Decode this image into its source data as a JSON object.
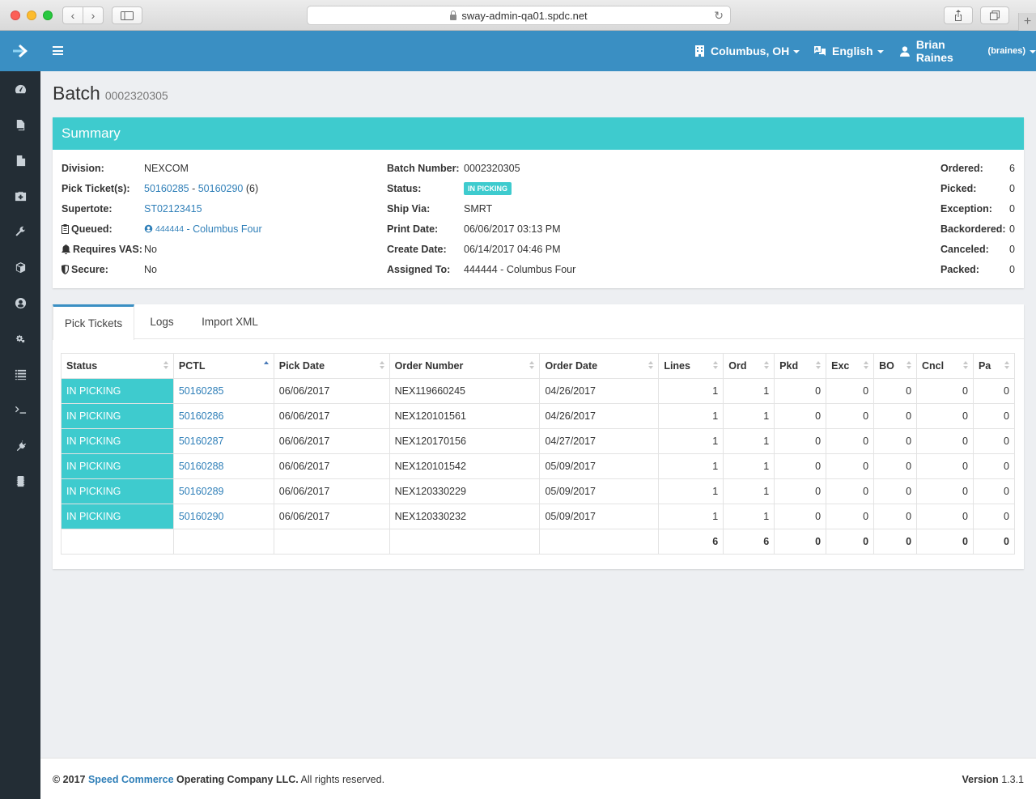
{
  "browser": {
    "url": "sway-admin-qa01.spdc.net"
  },
  "topbar": {
    "location": "Columbus, OH",
    "language": "English",
    "user_name": "Brian Raines",
    "user_login": "(braines)"
  },
  "page": {
    "title": "Batch",
    "subtitle": "0002320305"
  },
  "summary": {
    "title": "Summary",
    "division_label": "Division:",
    "division": "NEXCOM",
    "pick_tickets_label": "Pick Ticket(s):",
    "pick_ticket_first": "50160285",
    "pick_ticket_sep": " - ",
    "pick_ticket_last": "50160290",
    "pick_ticket_count": "(6)",
    "supertote_label": "Supertote:",
    "supertote": "ST02123415",
    "queued_label": "Queued:",
    "queued_id": "444444",
    "queued_name": " - Columbus Four",
    "vas_label": "Requires VAS:",
    "vas": "No",
    "secure_label": "Secure:",
    "secure": "No",
    "batch_number_label": "Batch Number:",
    "batch_number": "0002320305",
    "status_label": "Status:",
    "status": "IN PICKING",
    "ship_via_label": "Ship Via:",
    "ship_via": "SMRT",
    "print_date_label": "Print Date:",
    "print_date": "06/06/2017 03:13 PM",
    "create_date_label": "Create Date:",
    "create_date": "06/14/2017 04:46 PM",
    "assigned_to_label": "Assigned To:",
    "assigned_to": "444444 - Columbus Four",
    "ordered_label": "Ordered:",
    "ordered": "6",
    "picked_label": "Picked:",
    "picked": "0",
    "exception_label": "Exception:",
    "exception": "0",
    "backordered_label": "Backordered:",
    "backordered": "0",
    "canceled_label": "Canceled:",
    "canceled": "0",
    "packed_label": "Packed:",
    "packed": "0"
  },
  "tabs": [
    "Pick Tickets",
    "Logs",
    "Import XML"
  ],
  "table": {
    "headers": [
      "Status",
      "PCTL",
      "Pick Date",
      "Order Number",
      "Order Date",
      "Lines",
      "Ord",
      "Pkd",
      "Exc",
      "BO",
      "Cncl",
      "Pa"
    ],
    "rows": [
      [
        "IN PICKING",
        "50160285",
        "06/06/2017",
        "NEX119660245",
        "04/26/2017",
        "1",
        "1",
        "0",
        "0",
        "0",
        "0",
        "0"
      ],
      [
        "IN PICKING",
        "50160286",
        "06/06/2017",
        "NEX120101561",
        "04/26/2017",
        "1",
        "1",
        "0",
        "0",
        "0",
        "0",
        "0"
      ],
      [
        "IN PICKING",
        "50160287",
        "06/06/2017",
        "NEX120170156",
        "04/27/2017",
        "1",
        "1",
        "0",
        "0",
        "0",
        "0",
        "0"
      ],
      [
        "IN PICKING",
        "50160288",
        "06/06/2017",
        "NEX120101542",
        "05/09/2017",
        "1",
        "1",
        "0",
        "0",
        "0",
        "0",
        "0"
      ],
      [
        "IN PICKING",
        "50160289",
        "06/06/2017",
        "NEX120330229",
        "05/09/2017",
        "1",
        "1",
        "0",
        "0",
        "0",
        "0",
        "0"
      ],
      [
        "IN PICKING",
        "50160290",
        "06/06/2017",
        "NEX120330232",
        "05/09/2017",
        "1",
        "1",
        "0",
        "0",
        "0",
        "0",
        "0"
      ]
    ],
    "totals": [
      "6",
      "6",
      "0",
      "0",
      "0",
      "0",
      "0"
    ]
  },
  "footer": {
    "copy_prefix": "© 2017 ",
    "company": "Speed Commerce",
    "copy_suffix": " Operating Company LLC.",
    "rights": " All rights reserved.",
    "version_label": "Version",
    "version": "1.3.1"
  },
  "colors": {
    "primary": "#3a8fc3",
    "accent": "#3ecbce",
    "sidebar": "#232d35",
    "link": "#2f7fb8"
  }
}
